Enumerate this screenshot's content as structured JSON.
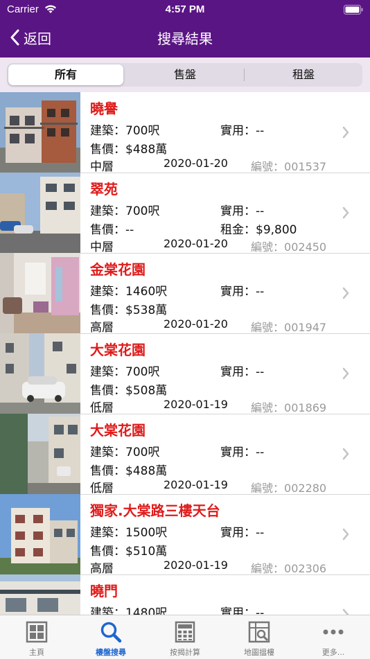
{
  "status_bar": {
    "carrier": "Carrier",
    "time": "4:57 PM"
  },
  "nav": {
    "back_label": "返回",
    "title": "搜尋結果"
  },
  "segments": [
    "所有",
    "售盤",
    "租盤"
  ],
  "labels": {
    "building": "建築",
    "usable": "實用",
    "price": "售價",
    "rent": "租金",
    "ref": "編號"
  },
  "listings": [
    {
      "name": "曉譽",
      "building_area": "700呎",
      "usable_area": "--",
      "price": "$488萬",
      "floor": "中層",
      "date": "2020-01-20",
      "ref_no": "001537"
    },
    {
      "name": "翠苑",
      "building_area": "700呎",
      "usable_area": "--",
      "price": "--",
      "rent": "$9,800",
      "floor": "中層",
      "date": "2020-01-20",
      "ref_no": "002450"
    },
    {
      "name": "金棠花園",
      "building_area": "1460呎",
      "usable_area": "--",
      "price": "$538萬",
      "floor": "高層",
      "date": "2020-01-20",
      "ref_no": "001947"
    },
    {
      "name": "大棠花園",
      "building_area": "700呎",
      "usable_area": "--",
      "price": "$508萬",
      "floor": "低層",
      "date": "2020-01-19",
      "ref_no": "001869"
    },
    {
      "name": "大棠花園",
      "building_area": "700呎",
      "usable_area": "--",
      "price": "$488萬",
      "floor": "低層",
      "date": "2020-01-19",
      "ref_no": "002280"
    },
    {
      "name": "獨家.大棠路三樓天台",
      "building_area": "1500呎",
      "usable_area": "--",
      "price": "$510萬",
      "floor": "高層",
      "date": "2020-01-19",
      "ref_no": "002306"
    },
    {
      "name": "曉門",
      "building_area": "1480呎",
      "usable_area": "--"
    }
  ],
  "tabs": [
    "主頁",
    "樓盤搜尋",
    "按揭計算",
    "地圖搵樓",
    "更多..."
  ],
  "colors": {
    "brand_purple": "#5a1584",
    "listing_name_red": "#e01b1b",
    "active_tab_blue": "#1e66d0"
  }
}
